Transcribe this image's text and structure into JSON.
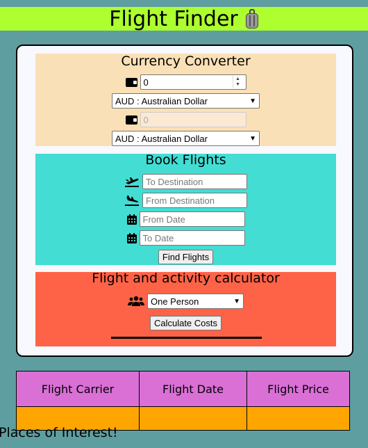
{
  "header": {
    "title": "Flight Finder",
    "icon": "luggage-icon"
  },
  "currency": {
    "title": "Currency Converter",
    "amount_value": "0",
    "from_currency": "AUD : Australian Dollar",
    "converted_value": "0",
    "to_currency": "AUD : Australian Dollar"
  },
  "flights": {
    "title": "Book Flights",
    "to_destination_placeholder": "To Destination",
    "from_destination_placeholder": "From Destination",
    "from_date_placeholder": "From Date",
    "to_date_placeholder": "To Date",
    "find_button": "Find Flights"
  },
  "calculator": {
    "title": "Flight and activity calculator",
    "party_size": "One Person",
    "calculate_button": "Calculate Costs"
  },
  "results": {
    "columns": [
      "Flight Carrier",
      "Flight Date",
      "Flight Price"
    ]
  },
  "places": {
    "title": "Places of Interest!"
  },
  "colors": {
    "background": "#5f9ea0",
    "header": "#adff2f",
    "currency_section": "#fae0b6",
    "flights_section": "#43ddd3",
    "calculator_section": "#ff6347",
    "table_header": "#da70d6",
    "table_row": "#ffa500"
  }
}
